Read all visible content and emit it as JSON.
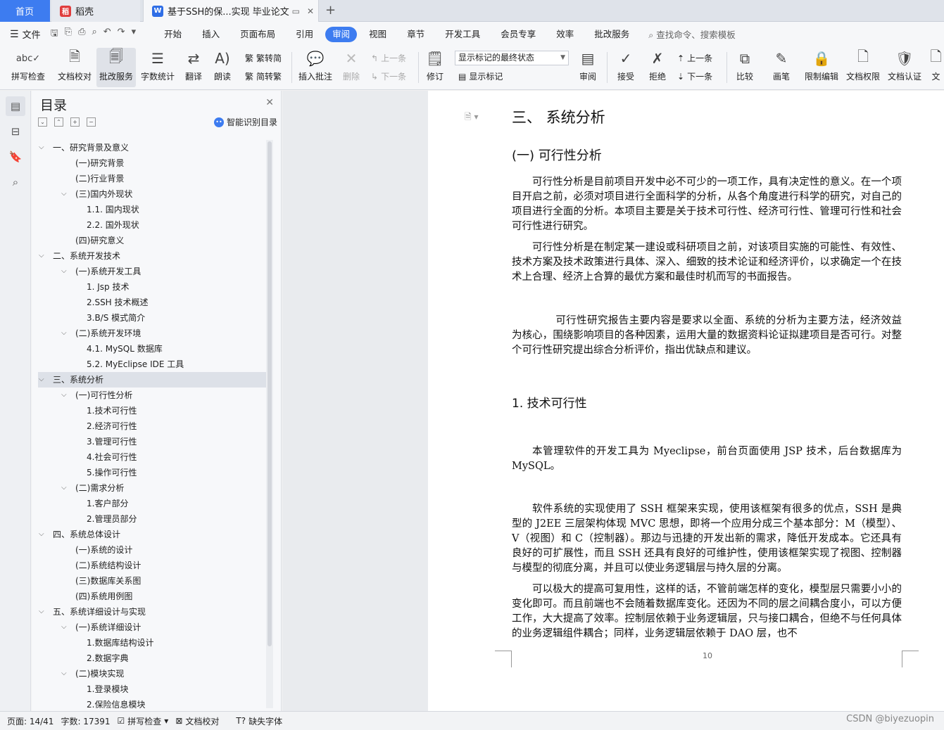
{
  "tabs": {
    "home": "首页",
    "daoke": "稻壳",
    "doc": "基于SSH的保...实现 毕业论文"
  },
  "menu": {
    "file": "文件",
    "items": [
      "开始",
      "插入",
      "页面布局",
      "引用",
      "审阅",
      "视图",
      "章节",
      "开发工具",
      "会员专享",
      "效率",
      "批改服务"
    ],
    "active": "审阅",
    "search": "查找命令、搜索模板"
  },
  "ribbon": {
    "spell": "拼写检查",
    "proof": "文档校对",
    "review_service": "批改服务",
    "word_count": "字数统计",
    "translate": "翻译",
    "read_aloud": "朗读",
    "trad_simp": "繁转简",
    "simp_trad": "简转繁",
    "insert_comment": "插入批注",
    "delete": "删除",
    "prev": "上一条",
    "next": "下一条",
    "track": "修订",
    "markup_state": "显示标记的最终状态",
    "show_markup": "显示标记",
    "review": "审阅",
    "accept": "接受",
    "reject": "拒绝",
    "prev2": "上一条",
    "next2": "下一条",
    "compare": "比较",
    "pen": "画笔",
    "restrict": "限制编辑",
    "doc_perm": "文档权限",
    "doc_cert": "文档认证",
    "doc_more": "文"
  },
  "toc": {
    "title": "目录",
    "smart": "智能识别目录",
    "items": [
      {
        "text": "一、研究背景及意义",
        "level": 0,
        "chev": true
      },
      {
        "text": "(一)研究背景",
        "level": 1,
        "chev": false
      },
      {
        "text": "(二)行业背景",
        "level": 1,
        "chev": false
      },
      {
        "text": "(三)国内外现状",
        "level": 1,
        "chev": true
      },
      {
        "text": "1.1. 国内现状",
        "level": 2,
        "chev": false
      },
      {
        "text": "2.2. 国外现状",
        "level": 2,
        "chev": false
      },
      {
        "text": "(四)研究意义",
        "level": 1,
        "chev": false
      },
      {
        "text": "二、系统开发技术",
        "level": 0,
        "chev": true
      },
      {
        "text": "(一)系统开发工具",
        "level": 1,
        "chev": true
      },
      {
        "text": "1. Jsp 技术",
        "level": 2,
        "chev": false
      },
      {
        "text": "2.SSH 技术概述",
        "level": 2,
        "chev": false
      },
      {
        "text": "3.B/S 模式简介",
        "level": 2,
        "chev": false
      },
      {
        "text": "(二)系统开发环境",
        "level": 1,
        "chev": true
      },
      {
        "text": "4.1. MySQL 数据库",
        "level": 2,
        "chev": false
      },
      {
        "text": "5.2. MyEclipse IDE 工具",
        "level": 2,
        "chev": false
      },
      {
        "text": "三、系统分析",
        "level": 0,
        "chev": true,
        "selected": true
      },
      {
        "text": "(一)可行性分析",
        "level": 1,
        "chev": true
      },
      {
        "text": "1.技术可行性",
        "level": 2,
        "chev": false
      },
      {
        "text": "2.经济可行性",
        "level": 2,
        "chev": false
      },
      {
        "text": "3.管理可行性",
        "level": 2,
        "chev": false
      },
      {
        "text": "4.社会可行性",
        "level": 2,
        "chev": false
      },
      {
        "text": "5.操作可行性",
        "level": 2,
        "chev": false
      },
      {
        "text": "(二)需求分析",
        "level": 1,
        "chev": true
      },
      {
        "text": "1.客户部分",
        "level": 2,
        "chev": false
      },
      {
        "text": "2.管理员部分",
        "level": 2,
        "chev": false
      },
      {
        "text": "四、系统总体设计",
        "level": 0,
        "chev": true
      },
      {
        "text": "(一)系统的设计",
        "level": 1,
        "chev": false
      },
      {
        "text": "(二)系统结构设计",
        "level": 1,
        "chev": false
      },
      {
        "text": "(三)数据库关系图",
        "level": 1,
        "chev": false
      },
      {
        "text": "(四)系统用例图",
        "level": 1,
        "chev": false
      },
      {
        "text": "五、系统详细设计与实现",
        "level": 0,
        "chev": true
      },
      {
        "text": "(一)系统详细设计",
        "level": 1,
        "chev": true
      },
      {
        "text": "1.数据库结构设计",
        "level": 2,
        "chev": false
      },
      {
        "text": "2.数据字典",
        "level": 2,
        "chev": false
      },
      {
        "text": "(二)模块实现",
        "level": 1,
        "chev": true
      },
      {
        "text": "1.登录模块",
        "level": 2,
        "chev": false
      },
      {
        "text": "2.保险信息模块",
        "level": 2,
        "chev": false
      }
    ]
  },
  "doc": {
    "h1": "三、  系统分析",
    "h2": "(一)    可行性分析",
    "p1": "可行性分析是目前项目开发中必不可少的一项工作，具有决定性的意义。在一个项目开启之前，必须对项目进行全面科学的分析，从各个角度进行科学的研究，对自己的项目进行全面的分析。本项目主要是关于技术可行性、经济可行性、管理可行性和社会可行性进行研究。",
    "p2": "可行性分析是在制定某一建设或科研项目之前，对该项目实施的可能性、有效性、技术方案及技术政策进行具体、深入、细致的技术论证和经济评价，以求确定一个在技术上合理、经济上合算的最优方案和最佳时机而写的书面报告。",
    "p3": "可行性研究报告主要内容是要求以全面、系统的分析为主要方法，经济效益为核心，围绕影响项目的各种因素，运用大量的数据资料论证拟建项目是否可行。对整个可行性研究提出综合分析评价，指出优缺点和建议。",
    "h3": "1.  技术可行性",
    "p4": "本管理软件的开发工具为 Myeclipse，前台页面使用 JSP 技术，后台数据库为 MySQL。",
    "p5": "软件系统的实现使用了 SSH 框架来实现，使用该框架有很多的优点，SSH 是典型的 J2EE 三层架构体现 MVC 思想，即将一个应用分成三个基本部分：M（模型）、V（视图）和 C（控制器）。那边与迅捷的开发出新的需求，降低开发成本。它还具有良好的可扩展性，而且 SSH 还具有良好的可维护性，使用该框架实现了视图、控制器与模型的彻底分离，并且可以使业务逻辑层与持久层的分离。",
    "p6": "可以极大的提高可复用性，这样的话，不管前端怎样的变化，模型层只需要小小的变化即可。而且前端也不会随着数据库变化。还因为不同的层之间耦合度小，可以方便工作，大大提高了效率。控制层依赖于业务逻辑层，只与接口耦合，但绝不与任何具体的业务逻辑组件耦合；同样，业务逻辑层依赖于 DAO 层，也不",
    "page_number": "10"
  },
  "status": {
    "page": "页面: 14/41",
    "words": "字数: 17391",
    "spell": "拼写检查",
    "proof": "文档校对",
    "missing_font": "缺失字体",
    "watermark": "CSDN @biyezuopin"
  }
}
